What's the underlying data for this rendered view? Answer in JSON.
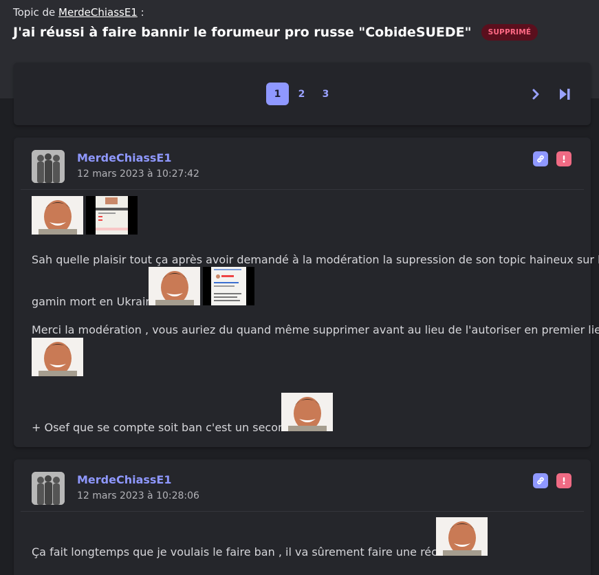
{
  "header": {
    "topic_prefix": "Topic de",
    "topic_author": "MerdeChiassE1",
    "topic_suffix": ":",
    "title": "J'ai réussi à faire bannir le forumeur pro russe \"CobideSUEDE\"",
    "status_badge": "SUPPRIMÉ"
  },
  "pagination": {
    "pages": [
      "1",
      "2",
      "3"
    ],
    "current": "1",
    "next_icon": "chevron-right-icon",
    "last_icon": "skip-to-end-icon"
  },
  "colors": {
    "accent": "#8f98ff",
    "danger": "#f06b84",
    "badge_bg": "#5a0f1d",
    "badge_text": "#ff6a85",
    "background": "#1e1f23",
    "card": "#25262b"
  },
  "posts": [
    {
      "author": "MerdeChiassE1",
      "date": "12 mars 2023 à 10:27:42",
      "link_icon": "link-icon",
      "report_icon": "exclamation-icon",
      "text_1": "Sah quelle plaisir tout ça après avoir demandé à la modération la supression de son topic haineux sur le",
      "text_2": "gamin mort en Ukraine",
      "text_3": "Merci la modération , vous auriez du quand même supprimer avant au lieu de l'autoriser en premier lieu",
      "text_4": "+ Osef que se compte soit ban c'est un secondaire"
    },
    {
      "author": "MerdeChiassE1",
      "date": "12 mars 2023 à 10:28:06",
      "link_icon": "link-icon",
      "report_icon": "exclamation-icon",
      "text_1": "Ça fait longtemps que je voulais le faire ban , il va sûrement faire une réclamation"
    }
  ]
}
